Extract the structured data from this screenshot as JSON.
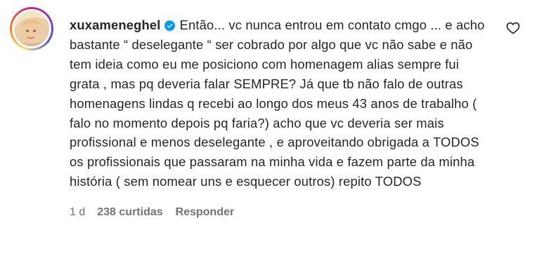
{
  "comment": {
    "username": "xuxameneghel",
    "verified_icon": "verified-badge-icon",
    "text": "Então... vc nunca entrou em contato cmgo ... e acho bastante “ deselegante “ ser cobrado por algo que vc não sabe e não tem ideia como eu me posiciono com homenagem alias sempre fui grata , mas pq deveria falar SEMPRE? Já que tb não falo de outras homenagens lindas q recebi ao longo dos meus 43 anos de trabalho ( falo no momento depois pq faria?) acho que vc deveria ser mais profissional e menos deselegante , e aproveitando obrigada a TODOS os profissionais que passaram na minha vida e fazem parte da minha história ( sem nomear uns e esquecer outros) repito TODOS",
    "age": "1 d",
    "likes": "238 curtidas",
    "reply_label": "Responder",
    "like_icon": "heart-outline-icon"
  },
  "colors": {
    "text": "#262626",
    "meta": "#737373",
    "verified": "#0095f6"
  }
}
